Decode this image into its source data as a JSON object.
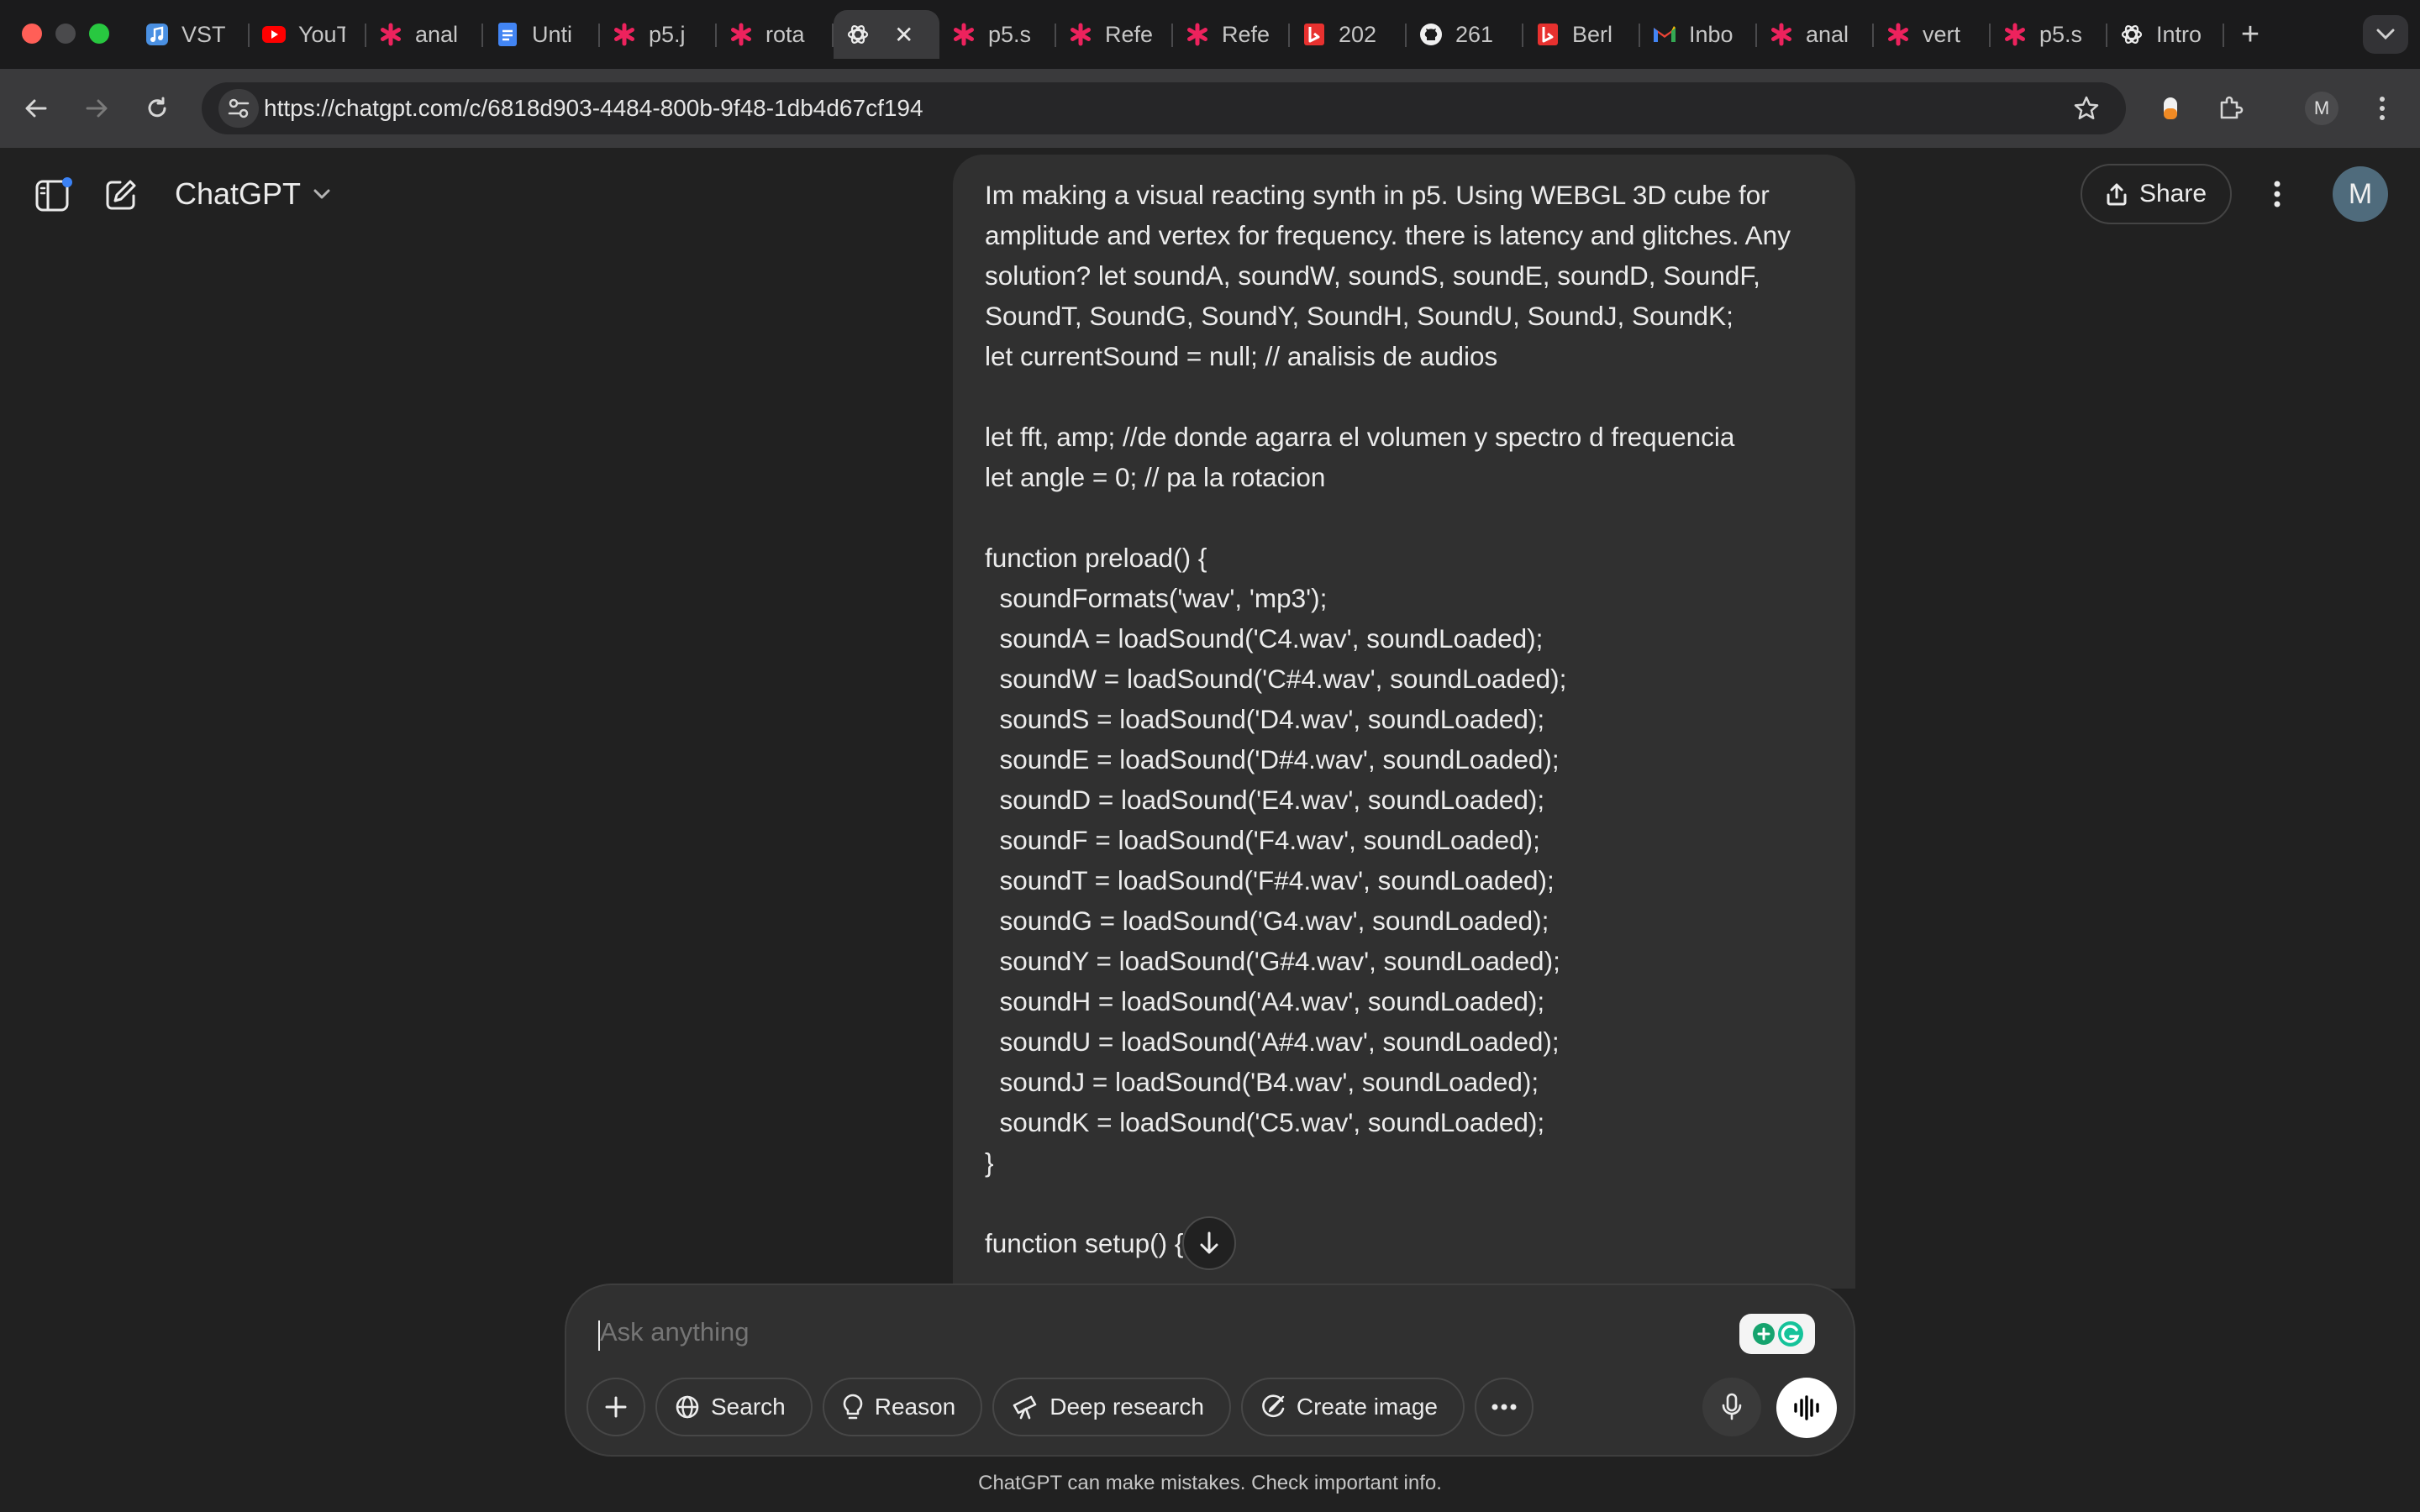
{
  "browser": {
    "tabs": [
      {
        "label": "VST",
        "icon": "music-icon"
      },
      {
        "label": "YouT",
        "icon": "youtube-icon"
      },
      {
        "label": "anal",
        "icon": "p5-asterisk-icon"
      },
      {
        "label": "Unti",
        "icon": "docs-icon"
      },
      {
        "label": "p5.j",
        "icon": "p5-asterisk-icon"
      },
      {
        "label": "rota",
        "icon": "p5-asterisk-icon"
      },
      {
        "label": "",
        "icon": "openai-icon",
        "active": true
      },
      {
        "label": "p5.s",
        "icon": "p5-asterisk-icon"
      },
      {
        "label": "Refe",
        "icon": "p5-asterisk-icon"
      },
      {
        "label": "Refe",
        "icon": "p5-asterisk-icon"
      },
      {
        "label": "202",
        "icon": "bing-icon"
      },
      {
        "label": "261",
        "icon": "github-icon"
      },
      {
        "label": "Berl",
        "icon": "bing-icon"
      },
      {
        "label": "Inbo",
        "icon": "gmail-icon"
      },
      {
        "label": "anal",
        "icon": "p5-asterisk-icon"
      },
      {
        "label": "vert",
        "icon": "p5-asterisk-icon"
      },
      {
        "label": "p5.s",
        "icon": "p5-asterisk-icon"
      },
      {
        "label": "Intro",
        "icon": "openai-icon"
      }
    ],
    "url": "https://chatgpt.com/c/6818d903-4484-800b-9f48-1db4d67cf194",
    "profile_initial": "M"
  },
  "header": {
    "model_name": "ChatGPT",
    "share_label": "Share",
    "avatar_initial": "M"
  },
  "message": {
    "intro": "Im making a visual reacting synth in p5. Using WEBGL 3D cube for amplitude and vertex for frequency. there is latency and glitches. Any solution? let soundA, soundW, soundS, soundE, soundD, SoundF, SoundT, SoundG, SoundY, SoundH, SoundU, SoundJ, SoundK;",
    "lines": [
      "let currentSound = null; // analisis de audios",
      "",
      "let fft, amp; //de donde agarra el volumen y spectro d frequencia",
      "let angle = 0; // pa la rotacion",
      "",
      "function preload() {",
      "  soundFormats('wav', 'mp3');",
      "  soundA = loadSound('C4.wav', soundLoaded);",
      "  soundW = loadSound('C#4.wav', soundLoaded);",
      "  soundS = loadSound('D4.wav', soundLoaded);",
      "  soundE = loadSound('D#4.wav', soundLoaded);",
      "  soundD = loadSound('E4.wav', soundLoaded);",
      "  soundF = loadSound('F4.wav', soundLoaded);",
      "  soundT = loadSound('F#4.wav', soundLoaded);",
      "  soundG = loadSound('G4.wav', soundLoaded);",
      "  soundY = loadSound('G#4.wav', soundLoaded);",
      "  soundH = loadSound('A4.wav', soundLoaded);",
      "  soundU = loadSound('A#4.wav', soundLoaded);",
      "  soundJ = loadSound('B4.wav', soundLoaded);",
      "  soundK = loadSound('C5.wav', soundLoaded);",
      "}",
      "",
      "function setup() {"
    ]
  },
  "composer": {
    "placeholder": "Ask anything",
    "buttons": {
      "search": "Search",
      "reason": "Reason",
      "deep_research": "Deep research",
      "create_image": "Create image"
    }
  },
  "disclaimer": "ChatGPT can make mistakes. Check important info.",
  "colors": {
    "background": "#212121",
    "bubble": "#303030",
    "p5_pink": "#ed225d",
    "notification_dot": "#3b82f6"
  }
}
